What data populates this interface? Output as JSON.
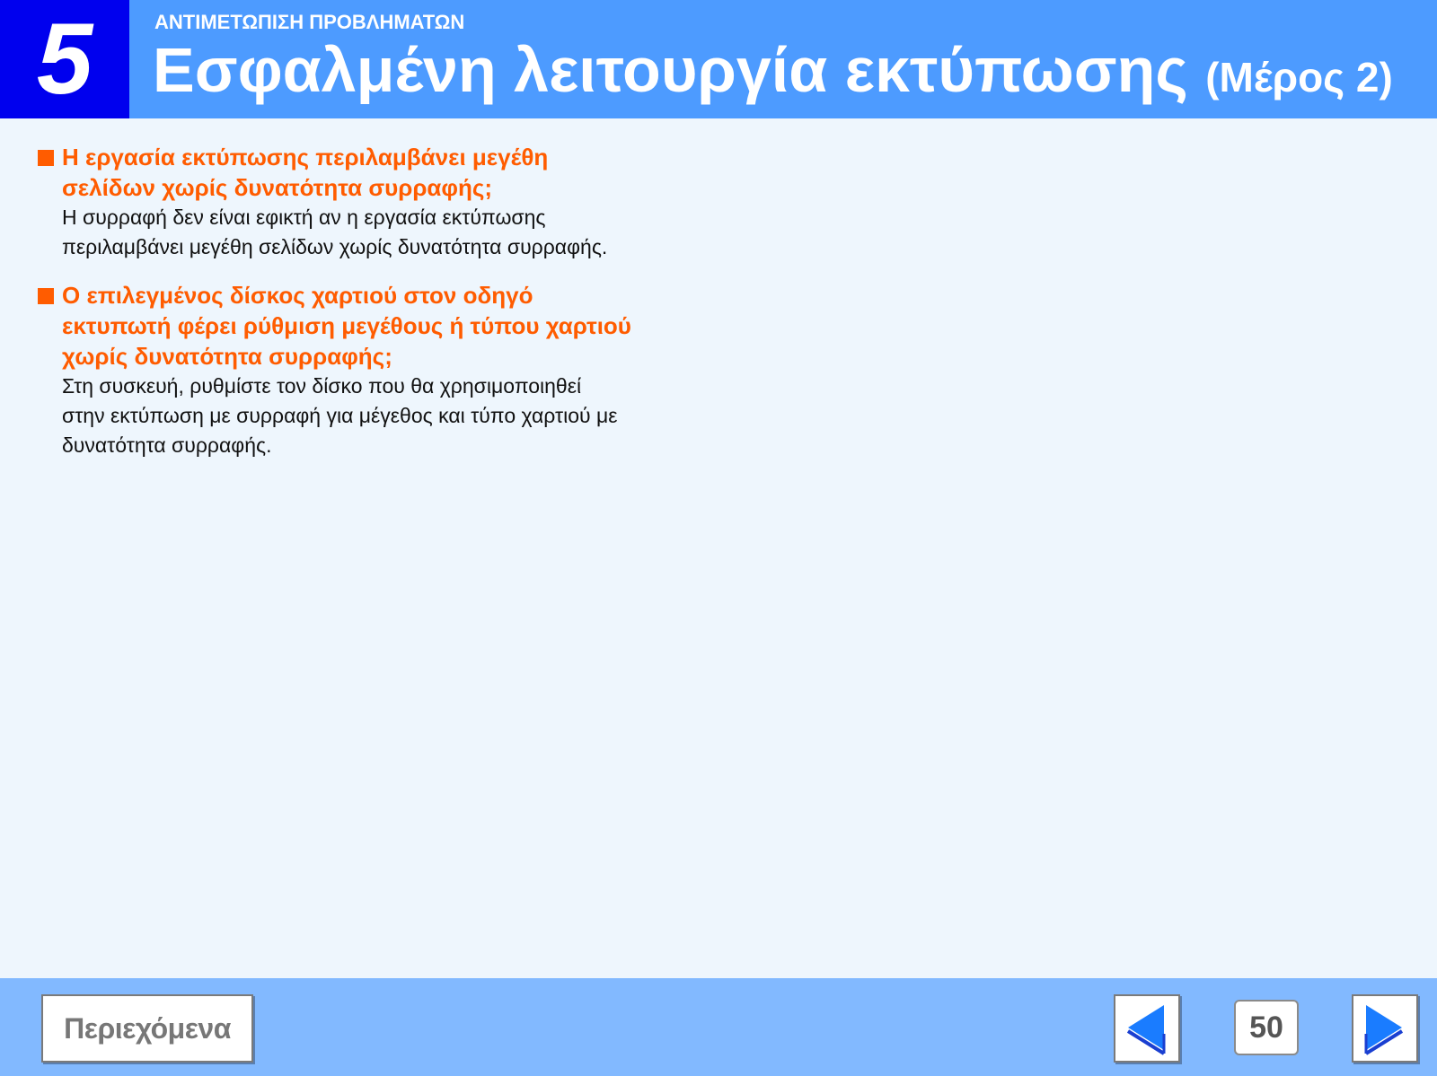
{
  "header": {
    "chapter_number": "5",
    "section_label": "ΑΝΤΙΜΕΤΩΠΙΣΗ ΠΡΟΒΛΗΜΑΤΩΝ",
    "title": "Εσφαλμένη λειτουργία εκτύπωσης",
    "title_part": "(Μέρος 2)"
  },
  "items": [
    {
      "question": "Η εργασία εκτύπωσης περιλαμβάνει μεγέθη\nσελίδων χωρίς δυνατότητα συρραφής;",
      "answer": "Η συρραφή δεν είναι εφικτή αν η εργασία εκτύπωσης\nπεριλαμβάνει μεγέθη σελίδων χωρίς δυνατότητα συρραφής."
    },
    {
      "question": "Ο επιλεγμένος δίσκος χαρτιού στον οδηγό\nεκτυπωτή φέρει ρύθμιση μεγέθους ή τύπου χαρτιού\nχωρίς δυνατότητα συρραφής;",
      "answer": "Στη συσκευή, ρυθμίστε τον δίσκο που θα χρησιμοποιηθεί\nστην εκτύπωση με συρραφή για μέγεθος και τύπο χαρτιού με\nδυνατότητα συρραφής."
    }
  ],
  "footer": {
    "contents_label": "Περιεχόμενα",
    "page_number": "50",
    "prev_icon": "left-arrow-icon",
    "next_icon": "right-arrow-icon"
  },
  "colors": {
    "header_bg": "#4d9bff",
    "chapter_bg": "#0000ee",
    "accent_orange": "#ff5c00",
    "page_bg": "#eef6fd",
    "footer_bg": "#82b9ff",
    "arrow_blue": "#1a7cff"
  }
}
